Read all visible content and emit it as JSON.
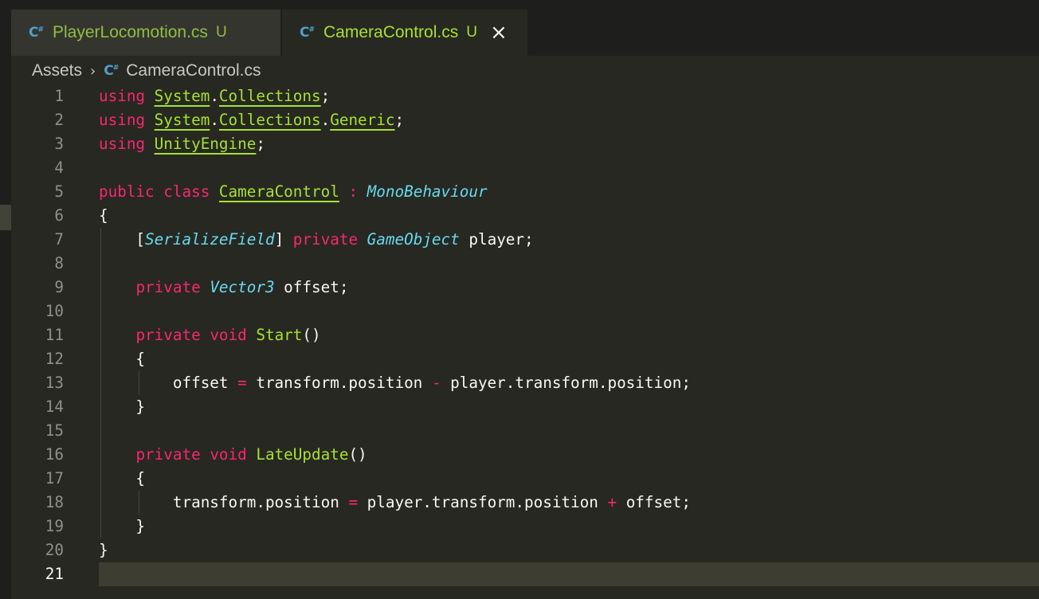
{
  "tabs": [
    {
      "icon": "csharp-file-icon",
      "label": "PlayerLocomotion.cs",
      "status": "U",
      "active": false
    },
    {
      "icon": "csharp-file-icon",
      "label": "CameraControl.cs",
      "status": "U",
      "active": true
    }
  ],
  "breadcrumb": {
    "folder": "Assets",
    "file": "CameraControl.cs"
  },
  "icon_text": {
    "cs": "C",
    "sharp": "#",
    "close": "×",
    "chevron": "›"
  },
  "editor": {
    "current_line": 21,
    "lines": [
      [
        {
          "t": "kw",
          "v": "using"
        },
        {
          "t": "p",
          "v": " "
        },
        {
          "t": "ns",
          "v": "System"
        },
        {
          "t": "p",
          "v": "."
        },
        {
          "t": "ns",
          "v": "Collections"
        },
        {
          "t": "p",
          "v": ";"
        }
      ],
      [
        {
          "t": "kw",
          "v": "using"
        },
        {
          "t": "p",
          "v": " "
        },
        {
          "t": "ns",
          "v": "System"
        },
        {
          "t": "p",
          "v": "."
        },
        {
          "t": "ns",
          "v": "Collections"
        },
        {
          "t": "p",
          "v": "."
        },
        {
          "t": "ns",
          "v": "Generic"
        },
        {
          "t": "p",
          "v": ";"
        }
      ],
      [
        {
          "t": "kw",
          "v": "using"
        },
        {
          "t": "p",
          "v": " "
        },
        {
          "t": "ns",
          "v": "UnityEngine"
        },
        {
          "t": "p",
          "v": ";"
        }
      ],
      [],
      [
        {
          "t": "kw",
          "v": "public"
        },
        {
          "t": "p",
          "v": " "
        },
        {
          "t": "kw",
          "v": "class"
        },
        {
          "t": "p",
          "v": " "
        },
        {
          "t": "cls",
          "v": "CameraControl"
        },
        {
          "t": "p",
          "v": " "
        },
        {
          "t": "op",
          "v": ":"
        },
        {
          "t": "p",
          "v": " "
        },
        {
          "t": "type",
          "v": "MonoBehaviour"
        }
      ],
      [
        {
          "t": "p",
          "v": "{"
        }
      ],
      [
        {
          "t": "p",
          "v": "    ["
        },
        {
          "t": "type",
          "v": "SerializeField"
        },
        {
          "t": "p",
          "v": "] "
        },
        {
          "t": "kw",
          "v": "private"
        },
        {
          "t": "p",
          "v": " "
        },
        {
          "t": "type",
          "v": "GameObject"
        },
        {
          "t": "p",
          "v": " player;"
        }
      ],
      [],
      [
        {
          "t": "p",
          "v": "    "
        },
        {
          "t": "kw",
          "v": "private"
        },
        {
          "t": "p",
          "v": " "
        },
        {
          "t": "type",
          "v": "Vector3"
        },
        {
          "t": "p",
          "v": " offset;"
        }
      ],
      [],
      [
        {
          "t": "p",
          "v": "    "
        },
        {
          "t": "kw",
          "v": "private"
        },
        {
          "t": "p",
          "v": " "
        },
        {
          "t": "kw",
          "v": "void"
        },
        {
          "t": "p",
          "v": " "
        },
        {
          "t": "fn",
          "v": "Start"
        },
        {
          "t": "p",
          "v": "()"
        }
      ],
      [
        {
          "t": "p",
          "v": "    {"
        }
      ],
      [
        {
          "t": "p",
          "v": "        offset "
        },
        {
          "t": "op",
          "v": "="
        },
        {
          "t": "p",
          "v": " transform.position "
        },
        {
          "t": "op",
          "v": "-"
        },
        {
          "t": "p",
          "v": " player.transform.position;"
        }
      ],
      [
        {
          "t": "p",
          "v": "    }"
        }
      ],
      [],
      [
        {
          "t": "p",
          "v": "    "
        },
        {
          "t": "kw",
          "v": "private"
        },
        {
          "t": "p",
          "v": " "
        },
        {
          "t": "kw",
          "v": "void"
        },
        {
          "t": "p",
          "v": " "
        },
        {
          "t": "fn",
          "v": "LateUpdate"
        },
        {
          "t": "p",
          "v": "()"
        }
      ],
      [
        {
          "t": "p",
          "v": "    {"
        }
      ],
      [
        {
          "t": "p",
          "v": "        transform.position "
        },
        {
          "t": "op",
          "v": "="
        },
        {
          "t": "p",
          "v": " player.transform.position "
        },
        {
          "t": "op",
          "v": "+"
        },
        {
          "t": "p",
          "v": " offset;"
        }
      ],
      [
        {
          "t": "p",
          "v": "    }"
        }
      ],
      [
        {
          "t": "p",
          "v": "}"
        }
      ],
      []
    ]
  },
  "colors": {
    "background": "#272822",
    "keyword": "#f92672",
    "function": "#a6e22e",
    "type": "#66d9ef",
    "text": "#f8f8f2",
    "line_number": "#90908a"
  }
}
